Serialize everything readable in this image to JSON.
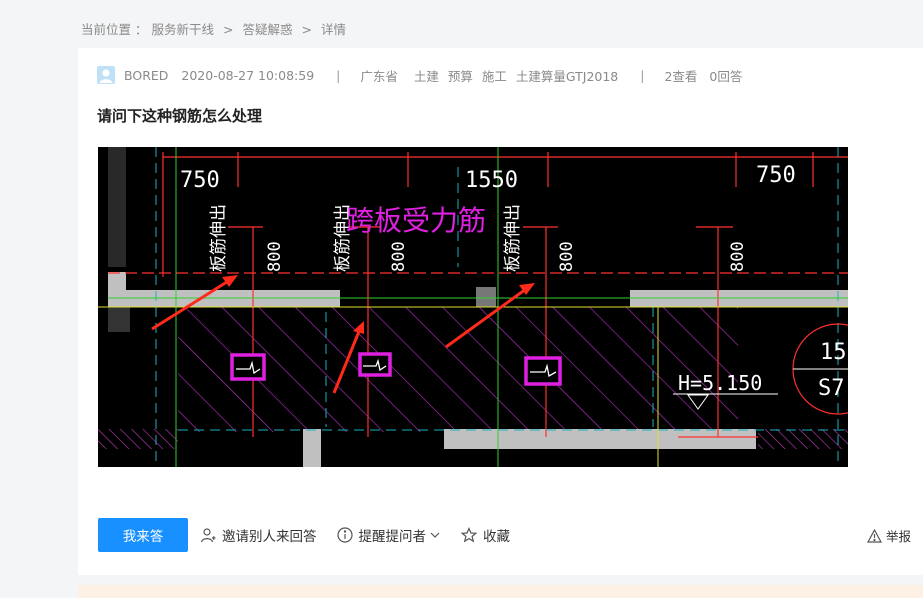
{
  "breadcrumb": {
    "label": "当前位置",
    "colon": "：",
    "items": [
      "服务新干线",
      "答疑解惑",
      "详情"
    ],
    "separator": ">"
  },
  "post": {
    "user": "BORED",
    "time": "2020-08-27 10:08:59",
    "divider": "|",
    "tags": [
      "广东省",
      "土建",
      "预算",
      "施工",
      "土建算量GTJ2018"
    ],
    "views": "2查看",
    "answers": "0回答",
    "title": "请问下这种钢筋怎么处理"
  },
  "drawing": {
    "dim_left": "750",
    "dim_mid": "1550",
    "dim_right": "750",
    "annotation": "跨板受力筋",
    "rebar_label": "板筋伸出",
    "length": "800",
    "elevation": "H=5.150",
    "circle_top": "15",
    "circle_bottom": "S7"
  },
  "actions": {
    "answer": "我来答",
    "invite": "邀请别人来回答",
    "remind": "提醒提问者",
    "favorite": "收藏",
    "report": "举报"
  },
  "colors": {
    "primary": "#1890ff",
    "magenta": "#e020e0",
    "arrow": "#ff2a1a"
  }
}
